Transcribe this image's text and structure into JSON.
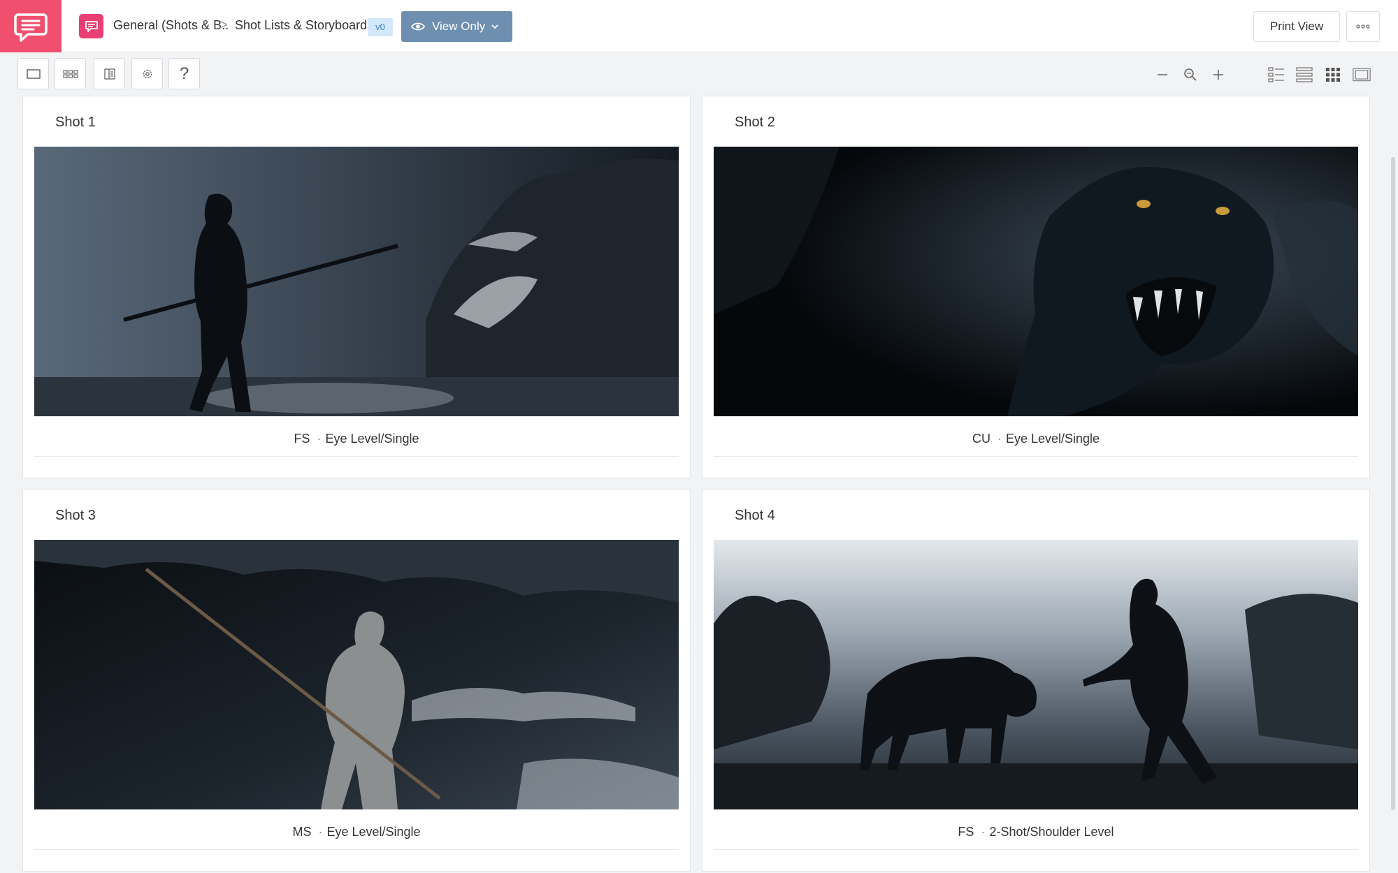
{
  "header": {
    "breadcrumb": [
      "General (Shots & B..",
      "Shot Lists & Storyboards"
    ],
    "breadcrumb_separator": ">",
    "version": "v0",
    "view_mode": "View Only",
    "print_label": "Print View",
    "more_icon": "more-dots-icon",
    "brand_color": "#f0506e",
    "project_color": "#ea3f74",
    "view_button_color": "#6e8fb0"
  },
  "toolbar": {
    "tools": [
      "single-frame-icon",
      "grid-view-icon",
      "panel-icon",
      "settings-gear-icon",
      "help-question-icon"
    ],
    "help_label": "?",
    "zoom": [
      "zoom-out-icon",
      "zoom-reset-icon",
      "zoom-in-icon"
    ],
    "layouts": [
      "list-detail-view-icon",
      "list-view-icon",
      "grid-view-icon",
      "filmstrip-view-icon"
    ]
  },
  "shots": [
    {
      "title": "Shot 1",
      "size": "FS",
      "angle": "Eye Level/Single",
      "separator": "·"
    },
    {
      "title": "Shot 2",
      "size": "CU",
      "angle": "Eye Level/Single",
      "separator": "·"
    },
    {
      "title": "Shot 3",
      "size": "MS",
      "angle": "Eye Level/Single",
      "separator": "·"
    },
    {
      "title": "Shot 4",
      "size": "FS",
      "angle": "2-Shot/Shoulder Level",
      "separator": "·"
    }
  ]
}
